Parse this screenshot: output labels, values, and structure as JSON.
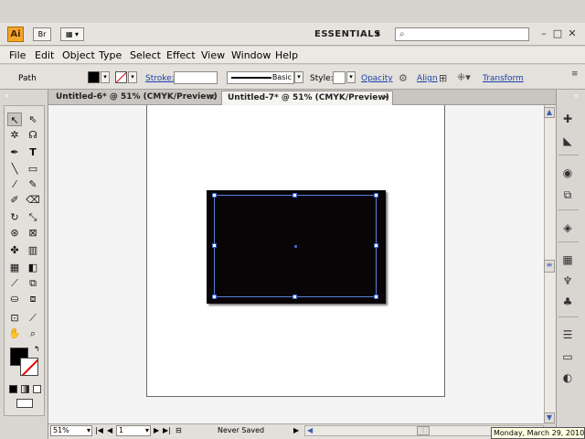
{
  "appbar": {
    "logo": "Ai",
    "bridge": "Br",
    "workspace": "ESSENTIALS",
    "search_placeholder": "",
    "min": "–",
    "max": "□",
    "close": "✕"
  },
  "menu": [
    "File",
    "Edit",
    "Object",
    "Type",
    "Select",
    "Effect",
    "View",
    "Window",
    "Help"
  ],
  "control": {
    "selection_type": "Path",
    "stroke_label": "Stroke:",
    "brush_label": "Basic",
    "style_label": "Style:",
    "opacity_label": "Opacity",
    "align_label": "Align",
    "transform_label": "Transform"
  },
  "tabs": [
    {
      "label": "Untitled-6* @ 51% (CMYK/Preview)",
      "active": false
    },
    {
      "label": "Untitled-7* @ 51% (CMYK/Preview)",
      "active": true
    }
  ],
  "status": {
    "zoom": "51%",
    "page": "1",
    "save_state": "Never Saved"
  },
  "tooltip": "Monday, March 29, 2010",
  "colors": {
    "rect_fill": "#090506",
    "selection": "#5a7fd8",
    "logo": "#f3a52b"
  }
}
